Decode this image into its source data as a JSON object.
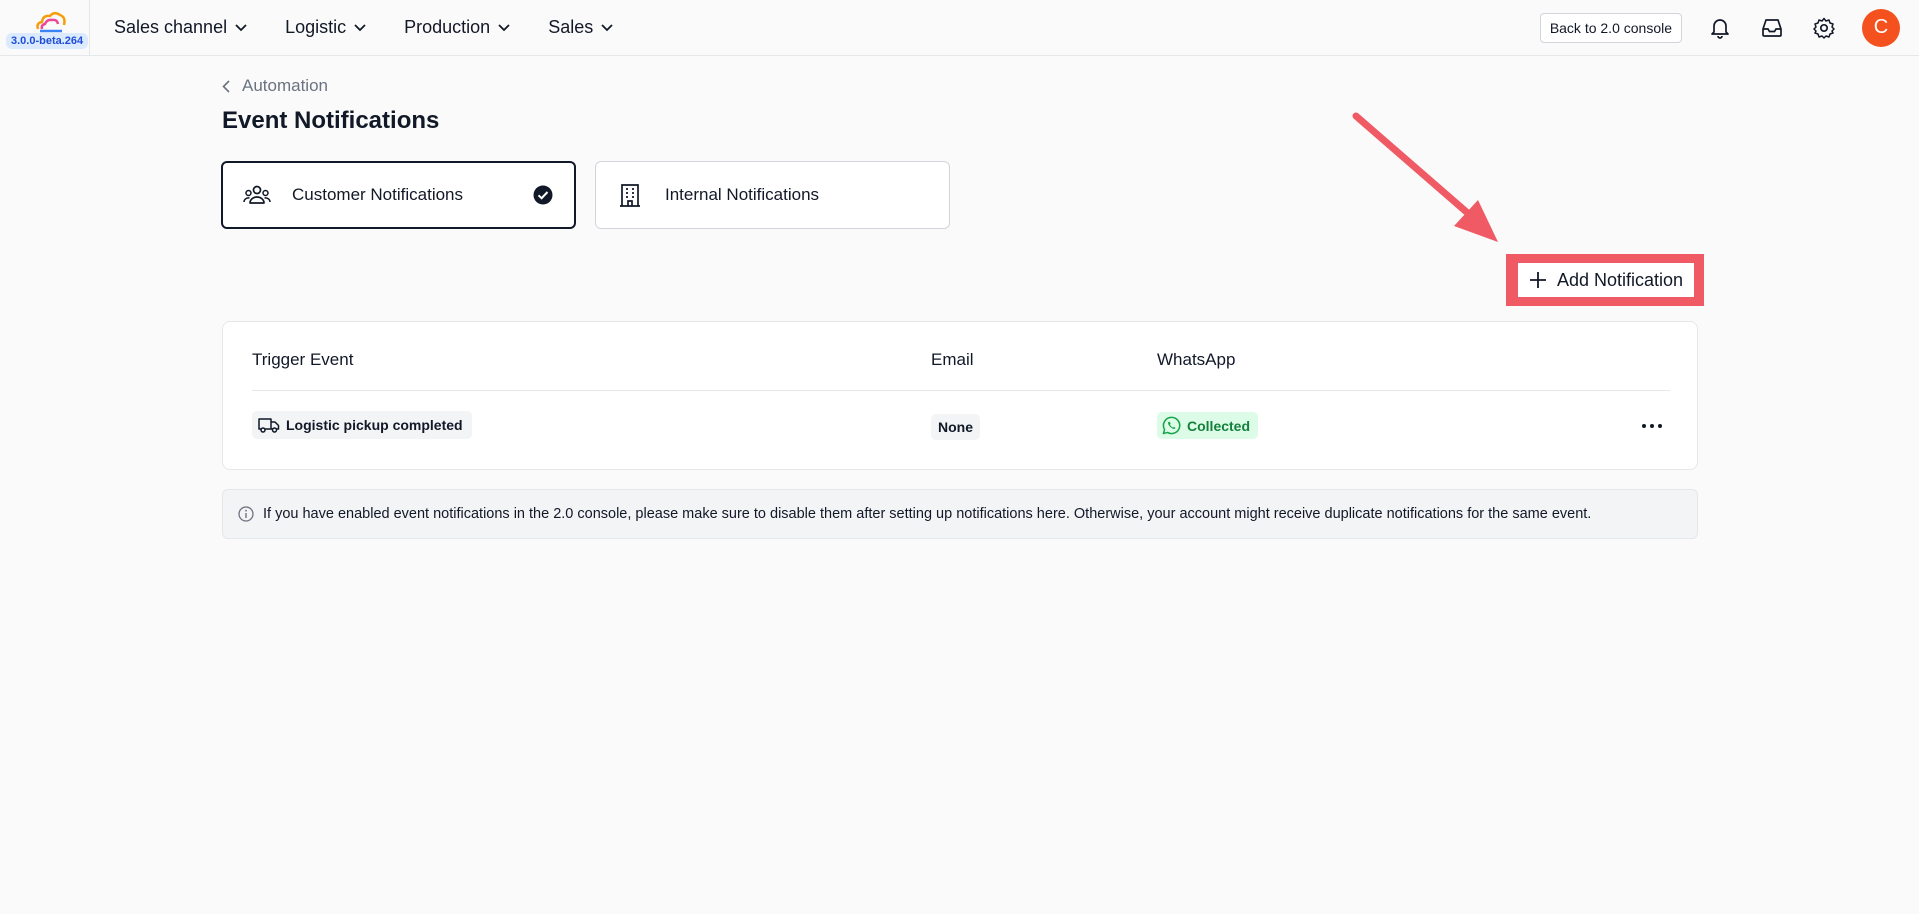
{
  "app": {
    "version": "3.0.0-beta.264"
  },
  "nav": {
    "items": [
      {
        "label": "Sales channel"
      },
      {
        "label": "Logistic"
      },
      {
        "label": "Production"
      },
      {
        "label": "Sales"
      }
    ],
    "back_button": "Back to 2.0 console",
    "avatar_initial": "C"
  },
  "breadcrumb": {
    "parent": "Automation"
  },
  "page": {
    "title": "Event Notifications"
  },
  "tabs": [
    {
      "label": "Customer Notifications",
      "selected": true,
      "icon": "users-icon"
    },
    {
      "label": "Internal Notifications",
      "selected": false,
      "icon": "building-icon"
    }
  ],
  "actions": {
    "add_notification": "Add Notification"
  },
  "table": {
    "columns": [
      "Trigger Event",
      "Email",
      "WhatsApp"
    ],
    "rows": [
      {
        "trigger": "Logistic pickup completed",
        "email": "None",
        "whatsapp": "Collected"
      }
    ]
  },
  "info": {
    "text": "If you have enabled event notifications in the 2.0 console, please make sure to disable them after setting up notifications here. Otherwise, your account might receive duplicate notifications for the same event."
  },
  "colors": {
    "accent": "#f4511e",
    "highlight": "#ef5a64",
    "whatsapp_bg": "#dcfce7",
    "whatsapp_text": "#15803d"
  }
}
